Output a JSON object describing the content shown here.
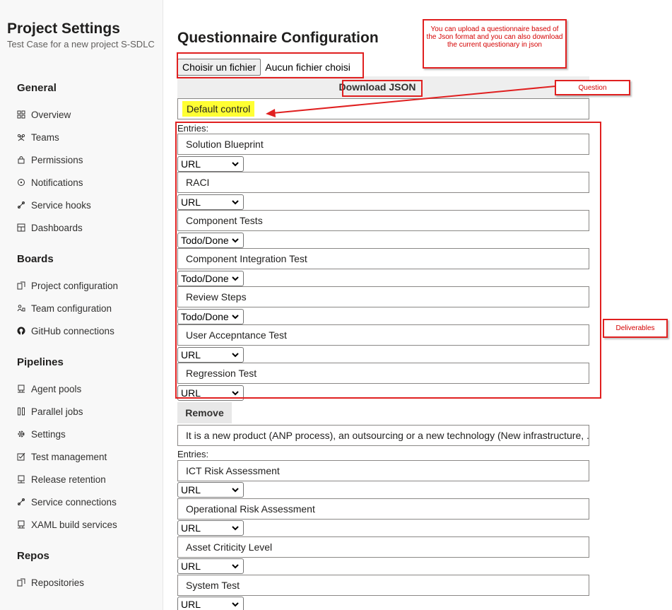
{
  "sidebar": {
    "title": "Project Settings",
    "subtitle": "Test Case for a new project S-SDLC",
    "sections": [
      {
        "label": "General",
        "items": [
          {
            "label": "Overview",
            "icon": "overview-icon"
          },
          {
            "label": "Teams",
            "icon": "teams-icon"
          },
          {
            "label": "Permissions",
            "icon": "lock-icon"
          },
          {
            "label": "Notifications",
            "icon": "notification-icon"
          },
          {
            "label": "Service hooks",
            "icon": "service-hooks-icon"
          },
          {
            "label": "Dashboards",
            "icon": "dashboard-icon"
          }
        ]
      },
      {
        "label": "Boards",
        "items": [
          {
            "label": "Project configuration",
            "icon": "project-config-icon"
          },
          {
            "label": "Team configuration",
            "icon": "team-config-icon"
          },
          {
            "label": "GitHub connections",
            "icon": "github-icon"
          }
        ]
      },
      {
        "label": "Pipelines",
        "items": [
          {
            "label": "Agent pools",
            "icon": "agent-pools-icon"
          },
          {
            "label": "Parallel jobs",
            "icon": "parallel-jobs-icon"
          },
          {
            "label": "Settings",
            "icon": "gear-icon"
          },
          {
            "label": "Test management",
            "icon": "test-management-icon"
          },
          {
            "label": "Release retention",
            "icon": "release-retention-icon"
          },
          {
            "label": "Service connections",
            "icon": "service-connections-icon"
          },
          {
            "label": "XAML build services",
            "icon": "xaml-build-icon"
          }
        ]
      },
      {
        "label": "Repos",
        "items": [
          {
            "label": "Repositories",
            "icon": "repositories-icon"
          }
        ]
      }
    ]
  },
  "main": {
    "title": "Questionnaire Configuration",
    "file": {
      "button_label": "Choisir un fichier",
      "status": "Aucun fichier choisi"
    },
    "download_label": "Download JSON",
    "remove_label": "Remove",
    "entries_label": "Entries:",
    "questions": [
      {
        "text": "Default control",
        "entries": [
          {
            "label": "Solution Blueprint",
            "type": "URL"
          },
          {
            "label": "RACI",
            "type": "URL"
          },
          {
            "label": "Component Tests",
            "type": "Todo/Done"
          },
          {
            "label": "Component Integration Test",
            "type": "Todo/Done"
          },
          {
            "label": "Review Steps",
            "type": "Todo/Done"
          },
          {
            "label": "User Accepntance Test",
            "type": "URL"
          },
          {
            "label": "Regression Test",
            "type": "URL"
          }
        ]
      },
      {
        "text": "It is a new product (ANP process), an outsourcing or a new technology (New infrastructure, ...",
        "entries": [
          {
            "label": "ICT Risk Assessment",
            "type": "URL"
          },
          {
            "label": "Operational Risk Assessment",
            "type": "URL"
          },
          {
            "label": "Asset Criticity Level",
            "type": "URL"
          },
          {
            "label": "System Test",
            "type": "URL"
          }
        ]
      }
    ]
  },
  "annotations": {
    "upload_note": "You can upload a questionnaire based of the Json format and you can also download the current questionary in json",
    "question_note": "Question",
    "deliverables_note": "Deliverables",
    "color": "#e02020"
  },
  "colors": {
    "highlight": "#ffff33",
    "sidebar_bg": "#f8f8f8",
    "download_bar_bg": "#eeeeee"
  }
}
